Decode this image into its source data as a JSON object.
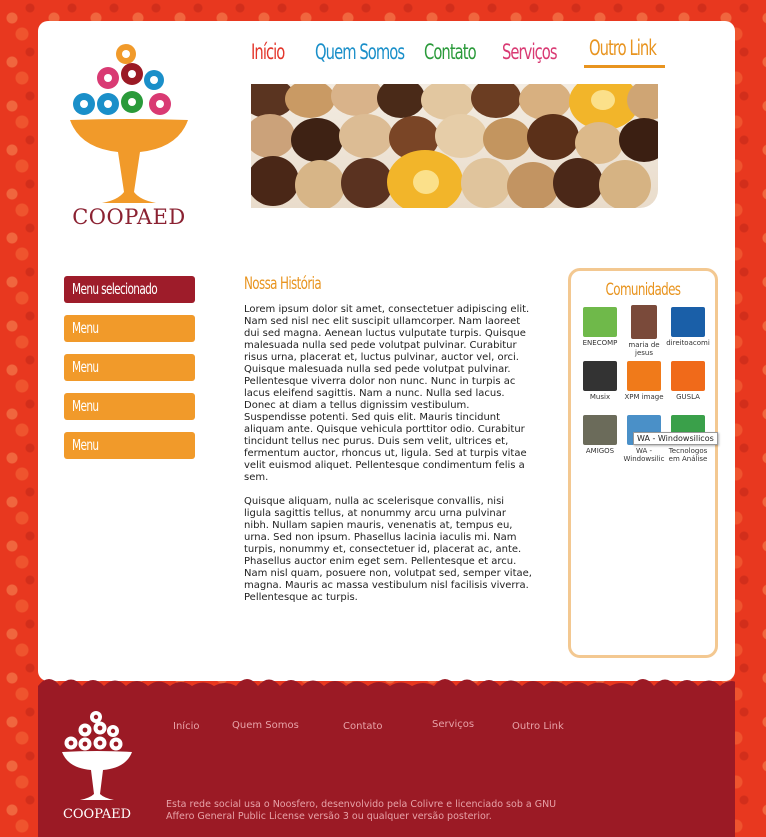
{
  "site": {
    "logo_text": "COOPAED"
  },
  "top_nav": {
    "items": [
      {
        "label": "Início",
        "color": "#e3362b"
      },
      {
        "label": "Quem Somos",
        "color": "#1a8fc9"
      },
      {
        "label": "Contato",
        "color": "#2a9a3a"
      },
      {
        "label": "Serviços",
        "color": "#d93a73"
      },
      {
        "label": "Outro Link",
        "color": "#e8941f"
      }
    ]
  },
  "side_menu": {
    "items": [
      {
        "label": "Menu selecionado",
        "active": true
      },
      {
        "label": "Menu"
      },
      {
        "label": "Menu"
      },
      {
        "label": "Menu"
      },
      {
        "label": "Menu"
      }
    ]
  },
  "content": {
    "title": "Nossa História",
    "paragraphs": [
      "Lorem ipsum dolor sit amet, consectetuer adipiscing elit. Nam sed nisl nec elit suscipit ullamcorper. Nam laoreet dui sed magna. Aenean luctus vulputate turpis. Quisque malesuada nulla sed pede volutpat pulvinar. Curabitur risus urna, placerat et, luctus pulvinar, auctor vel, orci. Quisque malesuada nulla sed pede volutpat pulvinar. Pellentesque viverra dolor non nunc. Nunc in turpis ac lacus eleifend sagittis. Nam a nunc. Nulla sed lacus. Donec at diam a tellus dignissim vestibulum. Suspendisse potenti. Sed quis elit. Mauris tincidunt aliquam ante. Quisque vehicula porttitor odio. Curabitur tincidunt tellus nec purus. Duis sem velit, ultrices et, fermentum auctor, rhoncus ut, ligula. Sed at turpis vitae velit euismod aliquet. Pellentesque condimentum felis a sem.",
      "Quisque aliquam, nulla ac scelerisque convallis, nisi ligula sagittis tellus, at nonummy arcu urna pulvinar nibh. Nullam sapien mauris, venenatis at, tempus eu, urna. Sed non ipsum. Phasellus lacinia iaculis mi. Nam turpis, nonummy et, consectetuer id, placerat ac, ante. Phasellus auctor enim eget sem. Pellentesque et arcu. Nam nisl quam, posuere non, volutpat sed, semper vitae, magna. Mauris ac massa vestibulum nisl facilisis viverra. Pellentesque ac turpis."
    ]
  },
  "communities": {
    "title": "Comunidades",
    "items": [
      {
        "label": "ENECOMP",
        "color": "#6fb94a"
      },
      {
        "label": "maria de jesus",
        "color": "#7a4a3a"
      },
      {
        "label": "direitoacomi",
        "color": "#1a5fa8"
      },
      {
        "label": "Musix",
        "color": "#333333"
      },
      {
        "label": "XPM image",
        "color": "#f07a1a"
      },
      {
        "label": "GUSLA",
        "color": "#f06a1a"
      },
      {
        "label": "AMIGOS",
        "color": "#6b6b5a"
      },
      {
        "label": "WA - Windowsilic",
        "color": "#4a90c8"
      },
      {
        "label": "Tecnologos em Análise",
        "color": "#3aa04a"
      }
    ],
    "tooltip": "WA - Windowsilicos"
  },
  "footer": {
    "logo_text": "COOPAED",
    "nav": [
      "Início",
      "Quem Somos",
      "Contato",
      "Serviços",
      "Outro Link"
    ],
    "note": "Esta rede social usa o Noosfero, desenvolvido pela Colivre e licenciado sob a GNU Affero General Public License versão 3 ou qualquer versão posterior."
  }
}
